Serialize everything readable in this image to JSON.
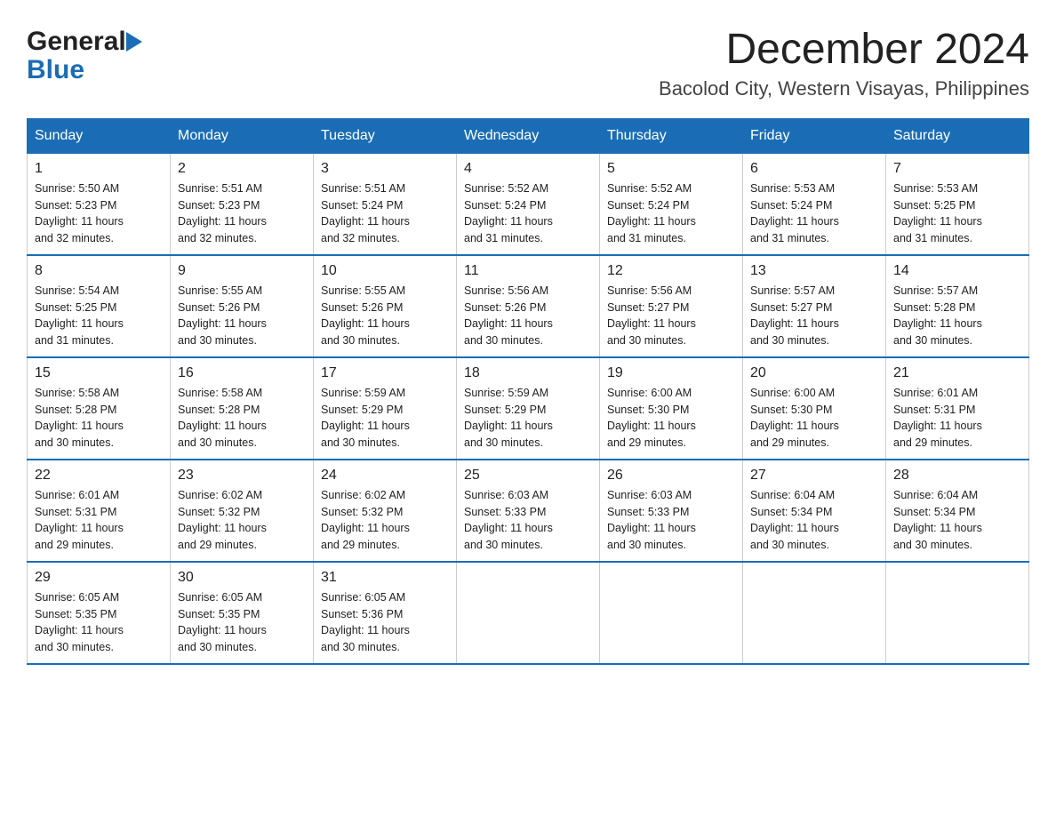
{
  "header": {
    "logo": {
      "general": "General",
      "blue": "Blue"
    },
    "title": "December 2024",
    "location": "Bacolod City, Western Visayas, Philippines"
  },
  "calendar": {
    "days_of_week": [
      "Sunday",
      "Monday",
      "Tuesday",
      "Wednesday",
      "Thursday",
      "Friday",
      "Saturday"
    ],
    "weeks": [
      [
        {
          "day": "1",
          "sunrise": "5:50 AM",
          "sunset": "5:23 PM",
          "daylight": "11 hours and 32 minutes."
        },
        {
          "day": "2",
          "sunrise": "5:51 AM",
          "sunset": "5:23 PM",
          "daylight": "11 hours and 32 minutes."
        },
        {
          "day": "3",
          "sunrise": "5:51 AM",
          "sunset": "5:24 PM",
          "daylight": "11 hours and 32 minutes."
        },
        {
          "day": "4",
          "sunrise": "5:52 AM",
          "sunset": "5:24 PM",
          "daylight": "11 hours and 31 minutes."
        },
        {
          "day": "5",
          "sunrise": "5:52 AM",
          "sunset": "5:24 PM",
          "daylight": "11 hours and 31 minutes."
        },
        {
          "day": "6",
          "sunrise": "5:53 AM",
          "sunset": "5:24 PM",
          "daylight": "11 hours and 31 minutes."
        },
        {
          "day": "7",
          "sunrise": "5:53 AM",
          "sunset": "5:25 PM",
          "daylight": "11 hours and 31 minutes."
        }
      ],
      [
        {
          "day": "8",
          "sunrise": "5:54 AM",
          "sunset": "5:25 PM",
          "daylight": "11 hours and 31 minutes."
        },
        {
          "day": "9",
          "sunrise": "5:55 AM",
          "sunset": "5:26 PM",
          "daylight": "11 hours and 30 minutes."
        },
        {
          "day": "10",
          "sunrise": "5:55 AM",
          "sunset": "5:26 PM",
          "daylight": "11 hours and 30 minutes."
        },
        {
          "day": "11",
          "sunrise": "5:56 AM",
          "sunset": "5:26 PM",
          "daylight": "11 hours and 30 minutes."
        },
        {
          "day": "12",
          "sunrise": "5:56 AM",
          "sunset": "5:27 PM",
          "daylight": "11 hours and 30 minutes."
        },
        {
          "day": "13",
          "sunrise": "5:57 AM",
          "sunset": "5:27 PM",
          "daylight": "11 hours and 30 minutes."
        },
        {
          "day": "14",
          "sunrise": "5:57 AM",
          "sunset": "5:28 PM",
          "daylight": "11 hours and 30 minutes."
        }
      ],
      [
        {
          "day": "15",
          "sunrise": "5:58 AM",
          "sunset": "5:28 PM",
          "daylight": "11 hours and 30 minutes."
        },
        {
          "day": "16",
          "sunrise": "5:58 AM",
          "sunset": "5:28 PM",
          "daylight": "11 hours and 30 minutes."
        },
        {
          "day": "17",
          "sunrise": "5:59 AM",
          "sunset": "5:29 PM",
          "daylight": "11 hours and 30 minutes."
        },
        {
          "day": "18",
          "sunrise": "5:59 AM",
          "sunset": "5:29 PM",
          "daylight": "11 hours and 30 minutes."
        },
        {
          "day": "19",
          "sunrise": "6:00 AM",
          "sunset": "5:30 PM",
          "daylight": "11 hours and 29 minutes."
        },
        {
          "day": "20",
          "sunrise": "6:00 AM",
          "sunset": "5:30 PM",
          "daylight": "11 hours and 29 minutes."
        },
        {
          "day": "21",
          "sunrise": "6:01 AM",
          "sunset": "5:31 PM",
          "daylight": "11 hours and 29 minutes."
        }
      ],
      [
        {
          "day": "22",
          "sunrise": "6:01 AM",
          "sunset": "5:31 PM",
          "daylight": "11 hours and 29 minutes."
        },
        {
          "day": "23",
          "sunrise": "6:02 AM",
          "sunset": "5:32 PM",
          "daylight": "11 hours and 29 minutes."
        },
        {
          "day": "24",
          "sunrise": "6:02 AM",
          "sunset": "5:32 PM",
          "daylight": "11 hours and 29 minutes."
        },
        {
          "day": "25",
          "sunrise": "6:03 AM",
          "sunset": "5:33 PM",
          "daylight": "11 hours and 30 minutes."
        },
        {
          "day": "26",
          "sunrise": "6:03 AM",
          "sunset": "5:33 PM",
          "daylight": "11 hours and 30 minutes."
        },
        {
          "day": "27",
          "sunrise": "6:04 AM",
          "sunset": "5:34 PM",
          "daylight": "11 hours and 30 minutes."
        },
        {
          "day": "28",
          "sunrise": "6:04 AM",
          "sunset": "5:34 PM",
          "daylight": "11 hours and 30 minutes."
        }
      ],
      [
        {
          "day": "29",
          "sunrise": "6:05 AM",
          "sunset": "5:35 PM",
          "daylight": "11 hours and 30 minutes."
        },
        {
          "day": "30",
          "sunrise": "6:05 AM",
          "sunset": "5:35 PM",
          "daylight": "11 hours and 30 minutes."
        },
        {
          "day": "31",
          "sunrise": "6:05 AM",
          "sunset": "5:36 PM",
          "daylight": "11 hours and 30 minutes."
        },
        null,
        null,
        null,
        null
      ]
    ]
  }
}
